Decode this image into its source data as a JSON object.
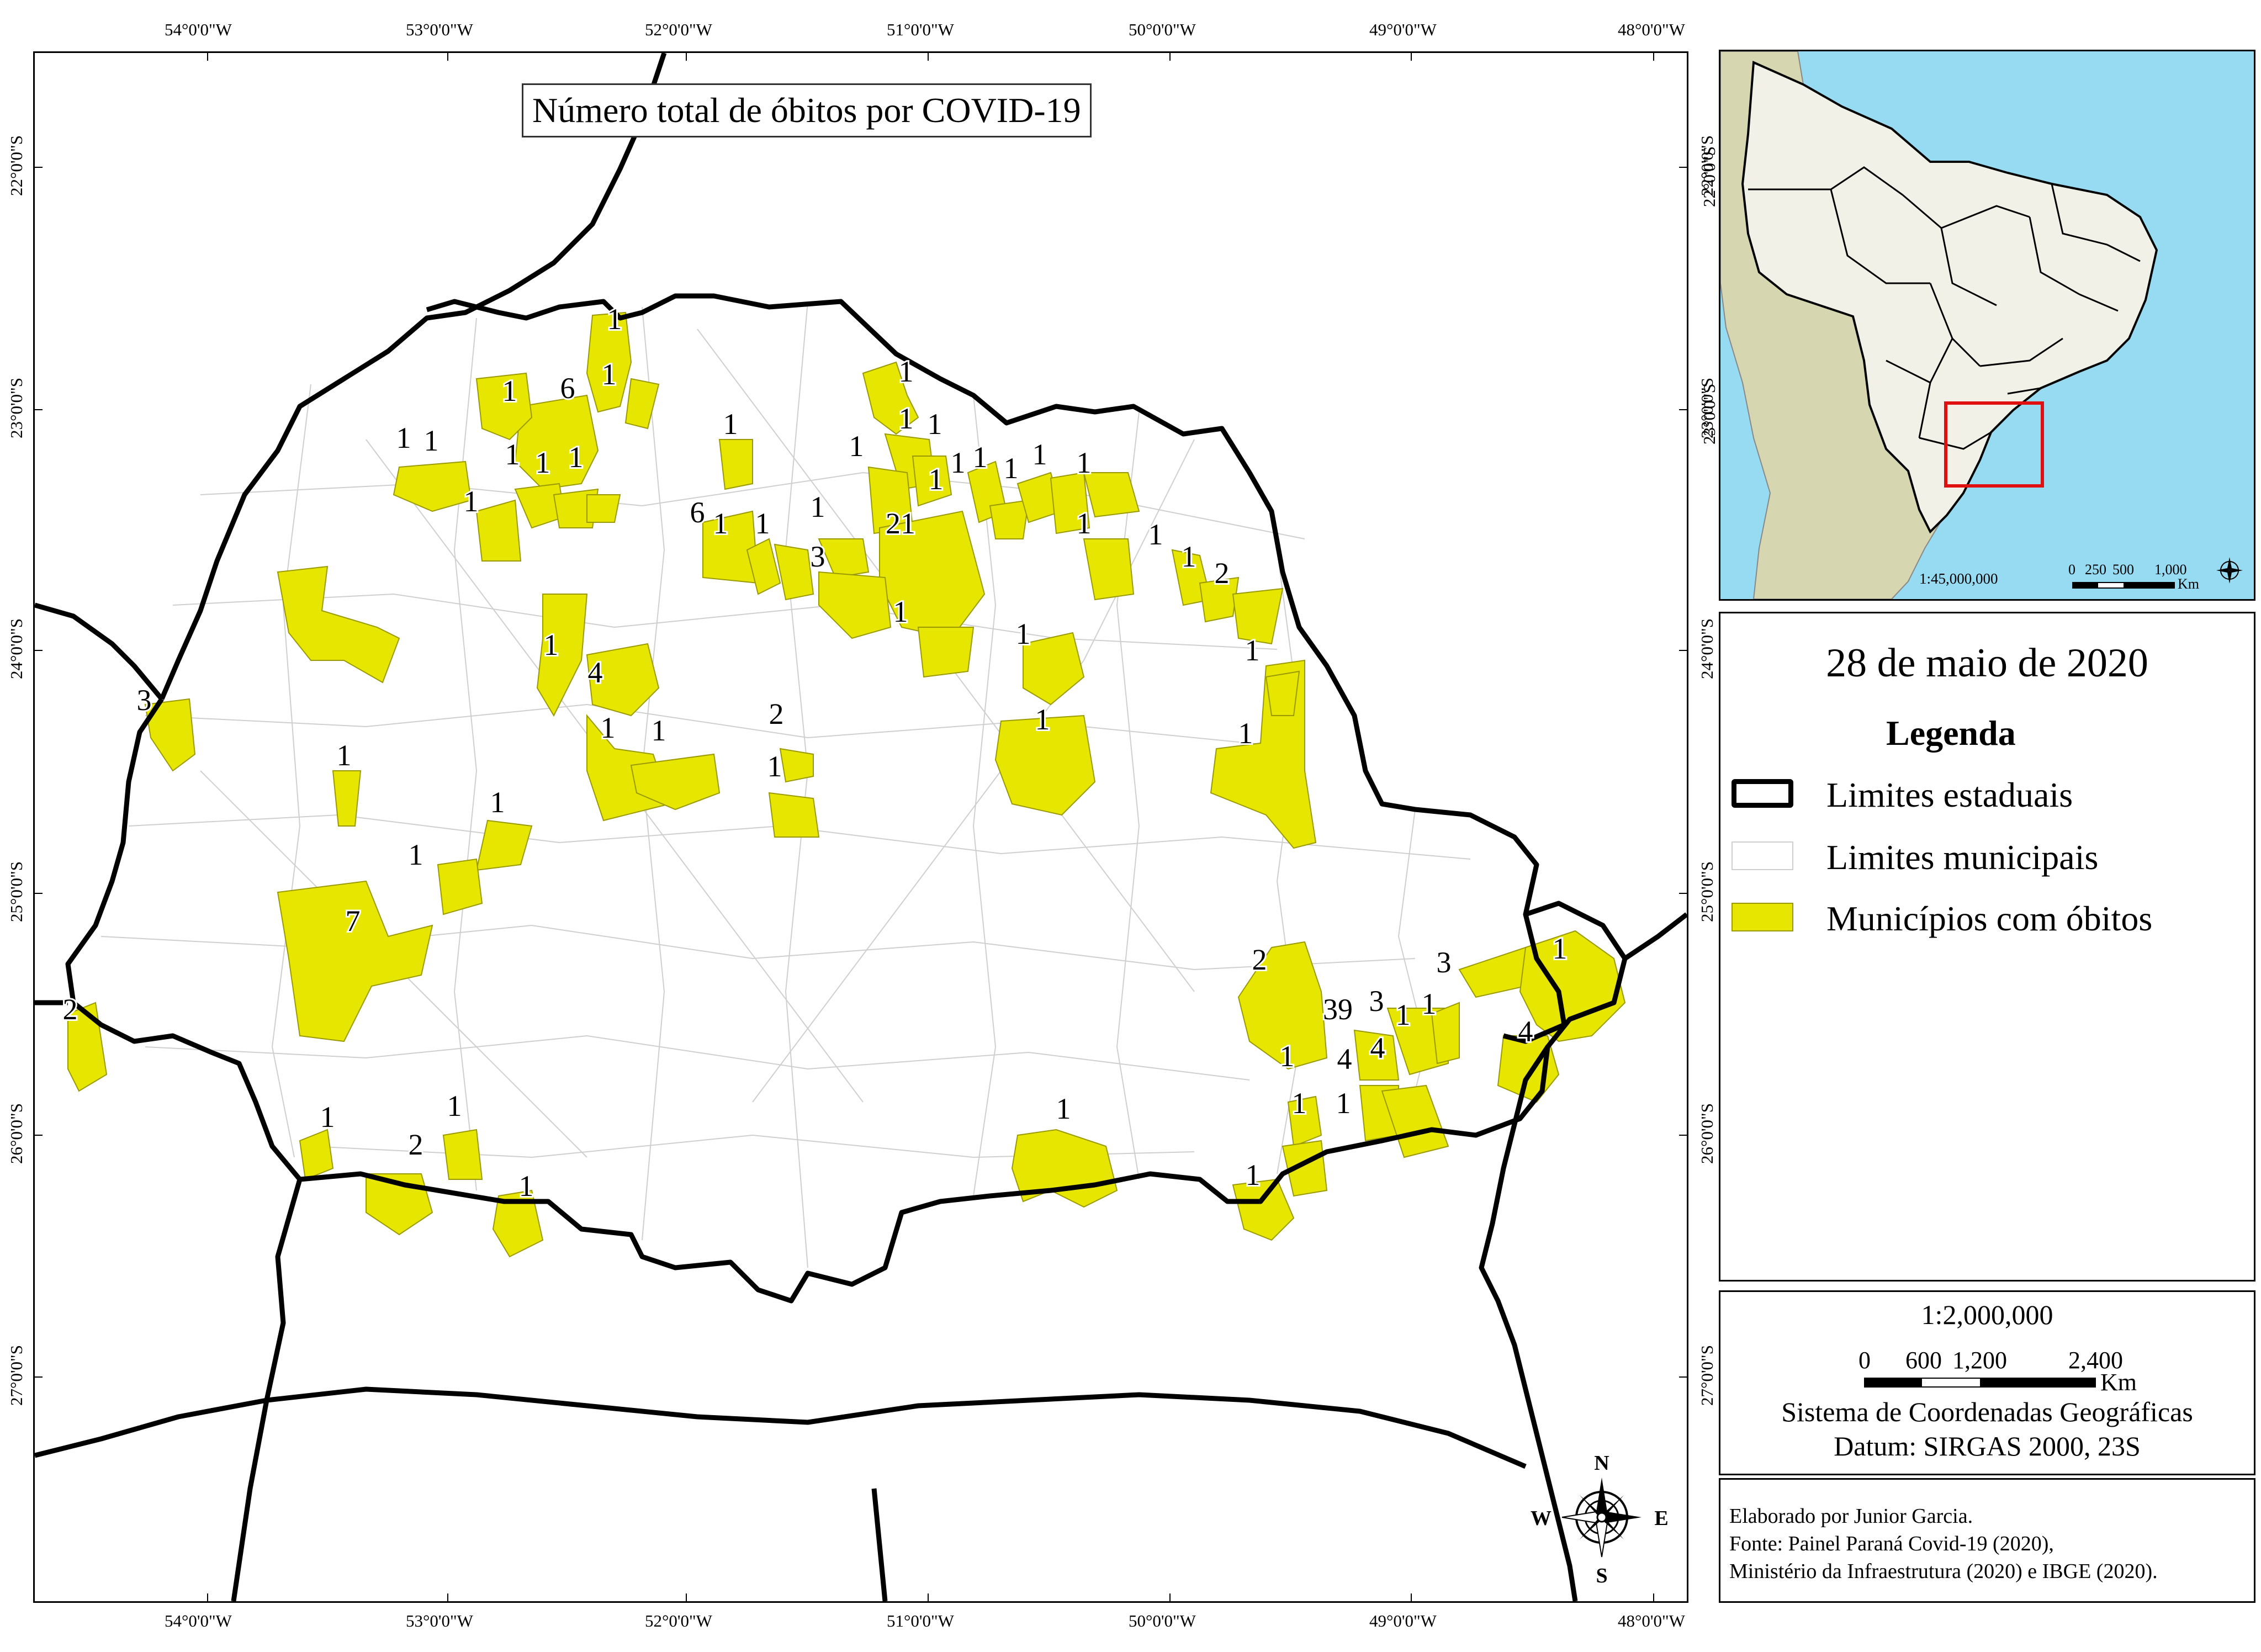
{
  "map_title": "Número total de óbitos por COVID-19",
  "date": "28 de maio de 2020",
  "legend": {
    "title": "Legenda",
    "items": [
      {
        "label": "Limites estaduais"
      },
      {
        "label": "Limites municipais"
      },
      {
        "label": "Municípios com óbitos"
      }
    ]
  },
  "colors": {
    "municipio_com_obitos": "#e6e600",
    "ocean": "#97dbf2",
    "south_america": "#d6d6b0",
    "brazil": "#f1f1e8",
    "inset_frame": "#e01010"
  },
  "scale_box": {
    "scale": "1:2,000,000",
    "ticks": [
      "0",
      "600",
      "1,200",
      "2,400"
    ],
    "unit": "Km",
    "coord_system": "Sistema de Coordenadas Geográficas",
    "datum": "Datum: SIRGAS 2000, 23S"
  },
  "inset": {
    "scale": "1:45,000,000",
    "ticks": [
      "0",
      "250",
      "500",
      "1,000"
    ],
    "unit": "Km",
    "lat_labels": [
      "22°0'0\"S",
      "23°0'0\"S"
    ]
  },
  "credits": [
    "Elaborado por Junior Garcia.",
    "Fonte: Painel Paraná Covid-19 (2020),",
    "Ministério da Infraestrutura (2020) e IBGE (2020)."
  ],
  "compass": {
    "n": "N",
    "s": "S",
    "e": "E",
    "w": "W"
  },
  "lon_labels": [
    "54°0'0\"W",
    "53°0'0\"W",
    "52°0'0\"W",
    "51°0'0\"W",
    "50°0'0\"W",
    "49°0'0\"W",
    "48°0'0\"W"
  ],
  "lat_labels": [
    "22°0'0\"S",
    "23°0'0\"S",
    "24°0'0\"S",
    "25°0'0\"S",
    "26°0'0\"S",
    "27°0'0\"S"
  ],
  "right_lat_labels": [
    "22°0'0\"S",
    "23°0'0\"S",
    "24°0'0\"S",
    "25°0'0\"S",
    "26°0'0\"S",
    "27°0'0\"S"
  ],
  "municipalities": [
    {
      "deaths": "1"
    },
    {
      "deaths": "6"
    },
    {
      "deaths": "1"
    },
    {
      "deaths": "1"
    },
    {
      "deaths": "1"
    },
    {
      "deaths": "1"
    },
    {
      "deaths": "1"
    },
    {
      "deaths": "1"
    },
    {
      "deaths": "1"
    },
    {
      "deaths": "1"
    },
    {
      "deaths": "1"
    },
    {
      "deaths": "1"
    },
    {
      "deaths": "1"
    },
    {
      "deaths": "6"
    },
    {
      "deaths": "1"
    },
    {
      "deaths": "1"
    },
    {
      "deaths": "1"
    },
    {
      "deaths": "1"
    },
    {
      "deaths": "21"
    },
    {
      "deaths": "3"
    },
    {
      "deaths": "1"
    },
    {
      "deaths": "1"
    },
    {
      "deaths": "1"
    },
    {
      "deaths": "1"
    },
    {
      "deaths": "1"
    },
    {
      "deaths": "1"
    },
    {
      "deaths": "1"
    },
    {
      "deaths": "1"
    },
    {
      "deaths": "1"
    },
    {
      "deaths": "2"
    },
    {
      "deaths": "1"
    },
    {
      "deaths": "1"
    },
    {
      "deaths": "1"
    },
    {
      "deaths": "1"
    },
    {
      "deaths": "1"
    },
    {
      "deaths": "1"
    },
    {
      "deaths": "4"
    },
    {
      "deaths": "1"
    },
    {
      "deaths": "1"
    },
    {
      "deaths": "3"
    },
    {
      "deaths": "1"
    },
    {
      "deaths": "2"
    },
    {
      "deaths": "1"
    },
    {
      "deaths": "1"
    },
    {
      "deaths": "1"
    },
    {
      "deaths": "1"
    },
    {
      "deaths": "7"
    },
    {
      "deaths": "2"
    },
    {
      "deaths": "1"
    },
    {
      "deaths": "2"
    },
    {
      "deaths": "1"
    },
    {
      "deaths": "1"
    },
    {
      "deaths": "1"
    },
    {
      "deaths": "2"
    },
    {
      "deaths": "39"
    },
    {
      "deaths": "3"
    },
    {
      "deaths": "1"
    },
    {
      "deaths": "1"
    },
    {
      "deaths": "3"
    },
    {
      "deaths": "1"
    },
    {
      "deaths": "4"
    },
    {
      "deaths": "4"
    },
    {
      "deaths": "1"
    },
    {
      "deaths": "4"
    },
    {
      "deaths": "1"
    },
    {
      "deaths": "1"
    },
    {
      "deaths": "1"
    }
  ]
}
